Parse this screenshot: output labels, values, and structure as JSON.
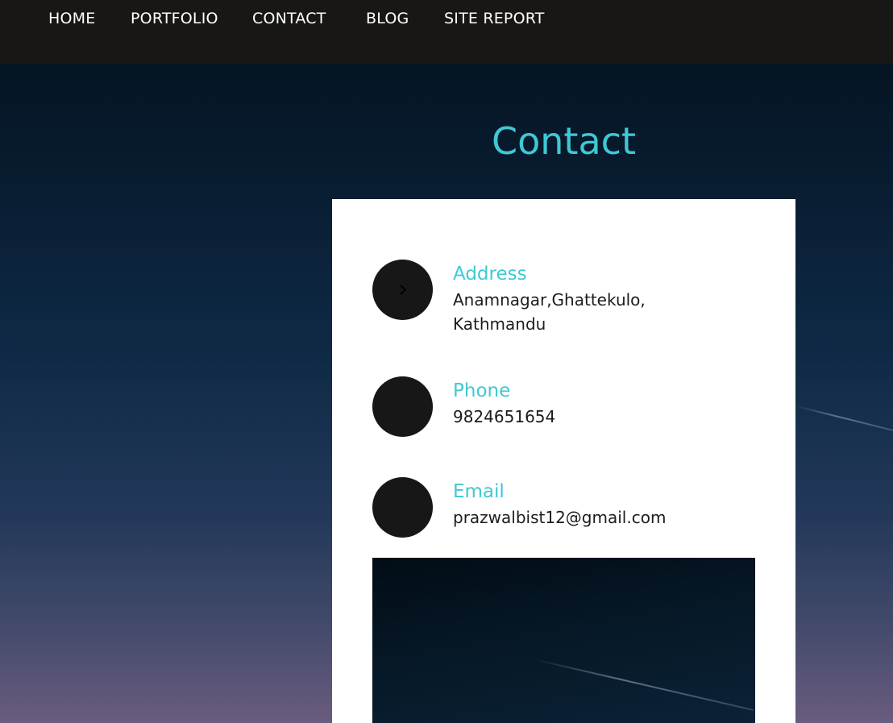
{
  "nav": {
    "items": [
      {
        "label": "HOME"
      },
      {
        "label": "PORTFOLIO"
      },
      {
        "label": "CONTACT"
      },
      {
        "label": "BLOG"
      },
      {
        "label": "SITE REPORT"
      }
    ]
  },
  "page": {
    "title": "Contact"
  },
  "contact": {
    "address": {
      "title": "Address",
      "value_line1": "Anamnagar,Ghattekulo,",
      "value_line2": "Kathmandu",
      "icon": "chevron-right-icon"
    },
    "phone": {
      "title": "Phone",
      "value": "9824651654"
    },
    "email": {
      "title": "Email",
      "value": "prazwalbist12@gmail.com"
    }
  },
  "colors": {
    "accent": "#3ec9d3",
    "navbar": "#181716",
    "icon_circle": "#171717",
    "card": "#ffffff",
    "text": "#1c1c1c"
  }
}
